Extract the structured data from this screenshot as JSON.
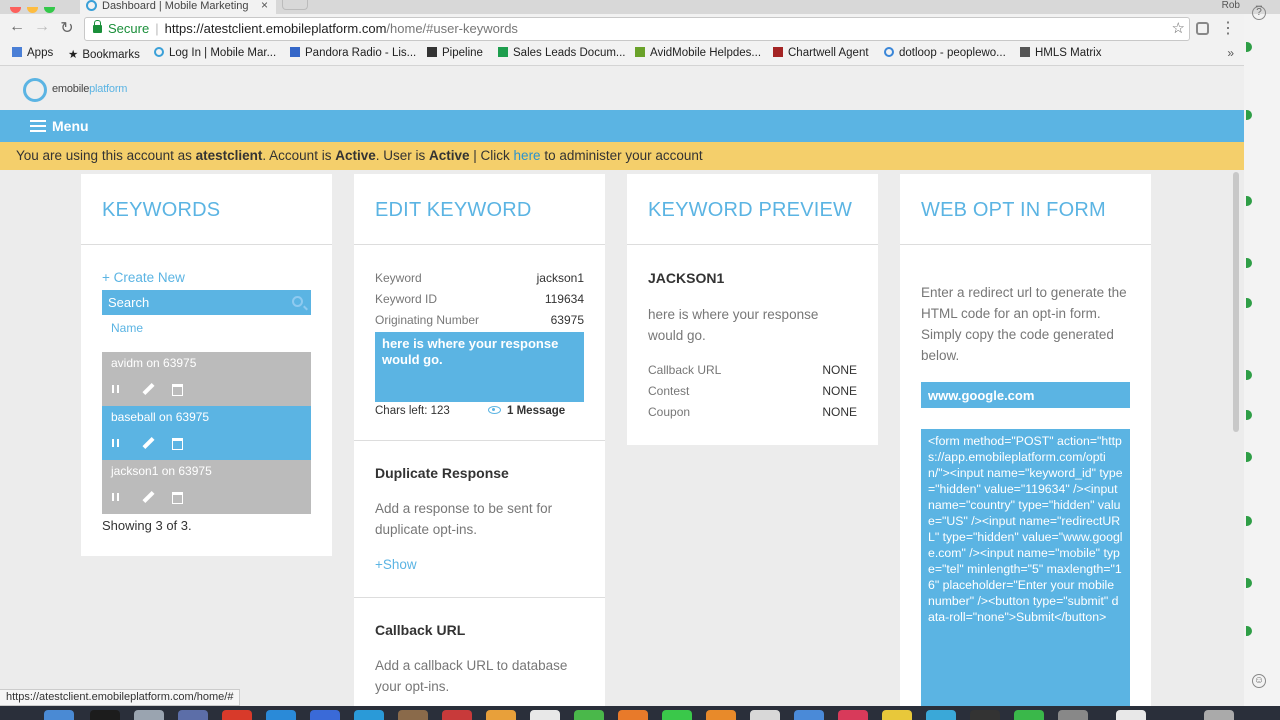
{
  "browser": {
    "tab_title": "Dashboard | Mobile Marketing",
    "tab_close": "×",
    "profile": "Rob",
    "back": "←",
    "forward": "→",
    "reload": "↻",
    "secure_label": "Secure",
    "url_host": "https://atestclient.emobileplatform.com",
    "url_path": "/home/#user-keywords",
    "star": "☆",
    "menu": "⋮",
    "bookmarks": [
      {
        "label": "Apps",
        "color": "#4a7fd6"
      },
      {
        "label": "Bookmarks",
        "color": "#333333"
      },
      {
        "label": "Log In | Mobile Mar...",
        "color": "#3aa0d8"
      },
      {
        "label": "Pandora Radio - Lis...",
        "color": "#3567c8"
      },
      {
        "label": "Pipeline",
        "color": "#333333"
      },
      {
        "label": "Sales Leads Docum...",
        "color": "#1e9e4e"
      },
      {
        "label": "AvidMobile Helpdes...",
        "color": "#6aa22a"
      },
      {
        "label": "Chartwell Agent",
        "color": "#a42424"
      },
      {
        "label": "dotloop - peoplewo...",
        "color": "#3a86d8"
      },
      {
        "label": "HMLS Matrix",
        "color": "#555555"
      }
    ],
    "bookmarks_more": "»",
    "status_url": "https://atestclient.emobileplatform.com/home/#"
  },
  "brand": {
    "logo_part1": "emobile",
    "logo_part2": "platform",
    "accent": "#5bb4e3"
  },
  "menu": {
    "label": "Menu"
  },
  "infobar": {
    "t1": "You are using this account as ",
    "account": "atestclient",
    "t2": ". Account is ",
    "account_status": "Active",
    "t3": ". User is ",
    "user_status": "Active",
    "t4": " | Click ",
    "link": "here",
    "t5": " to administer your account"
  },
  "keywords": {
    "title": "KEYWORDS",
    "create_new": "+ Create New",
    "search_placeholder": "Search",
    "sort_label": "Name",
    "items": [
      {
        "label": "avidm on 63975"
      },
      {
        "label": "baseball on 63975"
      },
      {
        "label": "jackson1 on 63975"
      }
    ],
    "showing": "Showing 3 of 3."
  },
  "edit": {
    "title": "EDIT KEYWORD",
    "rows": [
      {
        "label": "Keyword",
        "value": "jackson1"
      },
      {
        "label": "Keyword ID",
        "value": "119634"
      },
      {
        "label": "Originating Number",
        "value": "63975"
      }
    ],
    "response": "here is where your response would go.",
    "chars_left": "Chars left: 123",
    "message_count": "1 Message",
    "duplicate_title": "Duplicate Response",
    "duplicate_desc": "Add a response to be sent for duplicate opt-ins.",
    "show": "+Show",
    "callback_title": "Callback URL",
    "callback_desc": "Add a callback URL to database your opt-ins."
  },
  "preview": {
    "title": "KEYWORD PREVIEW",
    "keyword": "JACKSON1",
    "response": "here is where your response would go.",
    "rows": [
      {
        "label": "Callback URL",
        "value": "NONE"
      },
      {
        "label": "Contest",
        "value": "NONE"
      },
      {
        "label": "Coupon",
        "value": "NONE"
      }
    ]
  },
  "webopt": {
    "title": "WEB OPT IN FORM",
    "desc": "Enter a redirect url to generate the HTML code for an opt-in form. Simply copy the code generated below.",
    "redirect_value": "www.google.com",
    "code": "<form method=\"POST\" action=\"https://app.emobileplatform.com/optin/\"><input name=\"keyword_id\" type=\"hidden\" value=\"119634\" /><input name=\"country\" type=\"hidden\" value=\"US\" /><input name=\"redirectURL\" type=\"hidden\" value=\"www.google.com\" /><input name=\"mobile\" type=\"tel\" minlength=\"5\" maxlength=\"16\" placeholder=\"Enter your mobile number\" /><button type=\"submit\" data-roll=\"none\">Submit</button>"
  }
}
